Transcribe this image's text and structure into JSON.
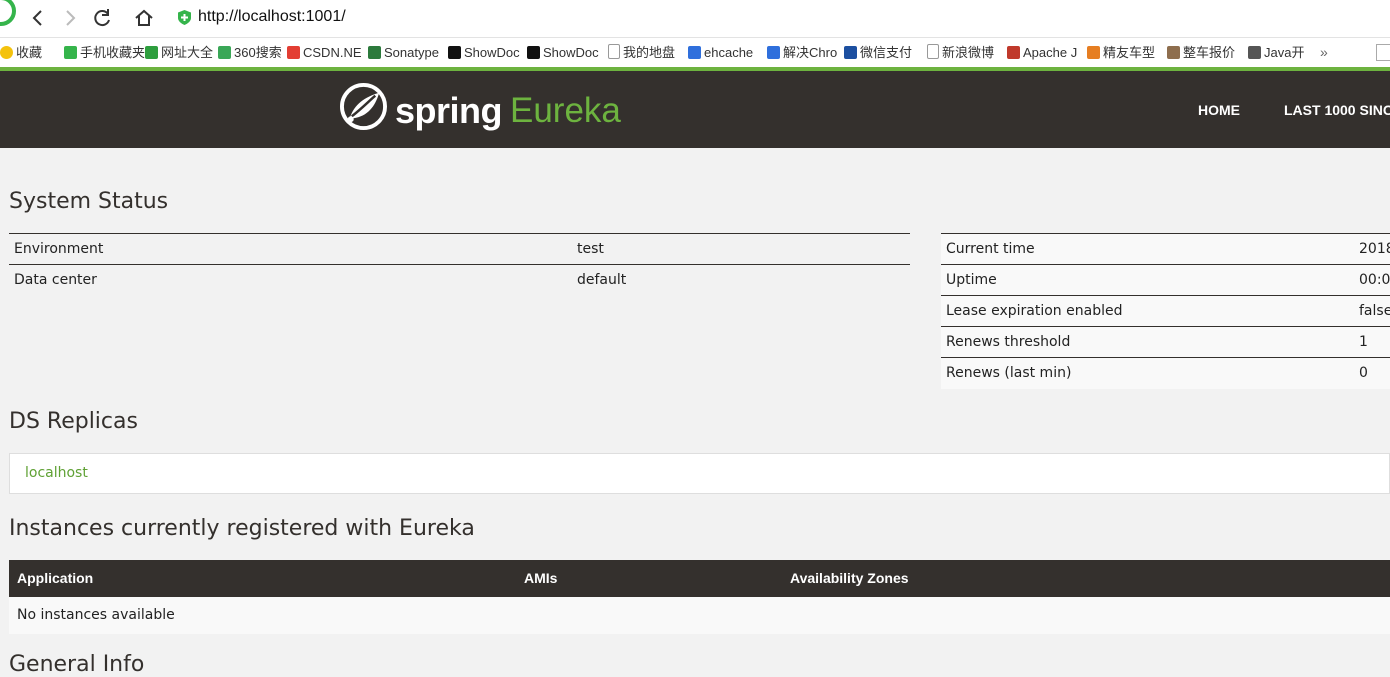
{
  "browser": {
    "url": "http://localhost:1001/",
    "bookmarks": [
      {
        "label": "收藏",
        "icon": "star-icon",
        "color": "#f4c20d"
      },
      {
        "label": "手机收藏夹",
        "icon": "phone-icon",
        "color": "#35b44b"
      },
      {
        "label": "网址大全",
        "icon": "globe-icon",
        "color": "#2e9e3e"
      },
      {
        "label": "360搜索",
        "icon": "search-360-icon",
        "color": "#3aa757"
      },
      {
        "label": "CSDN.NE",
        "icon": "csdn-icon",
        "color": "#e33e33"
      },
      {
        "label": "Sonatype",
        "icon": "sonatype-icon",
        "color": "#2c7a3c"
      },
      {
        "label": "ShowDoc",
        "icon": "showdoc-icon",
        "color": "#111111"
      },
      {
        "label": "ShowDoc",
        "icon": "showdoc-icon",
        "color": "#111111"
      },
      {
        "label": "我的地盘",
        "icon": "page-icon",
        "color": "#999999"
      },
      {
        "label": "ehcache",
        "icon": "baidu-paw-icon",
        "color": "#2f6fdc"
      },
      {
        "label": "解决Chro",
        "icon": "baidu-paw-icon",
        "color": "#2f6fdc"
      },
      {
        "label": "微信支付",
        "icon": "wechat-pay-icon",
        "color": "#1c4fa0"
      },
      {
        "label": "新浪微博",
        "icon": "page-icon",
        "color": "#999999"
      },
      {
        "label": "Apache J",
        "icon": "apache-feather-icon",
        "color": "#c0392b"
      },
      {
        "label": "精友车型",
        "icon": "jingyou-icon",
        "color": "#e67e22"
      },
      {
        "label": "整车报价",
        "icon": "image-icon",
        "color": "#8e6e4e"
      },
      {
        "label": "Java开",
        "icon": "java-icon",
        "color": "#555555"
      }
    ],
    "more_label": "»"
  },
  "header": {
    "logo_spring": "spring",
    "logo_eureka": "Eureka",
    "nav": [
      "HOME",
      "LAST 1000 SINC"
    ]
  },
  "system_status": {
    "title": "System Status",
    "left": [
      {
        "label": "Environment",
        "value": "test"
      },
      {
        "label": "Data center",
        "value": "default"
      }
    ],
    "right": [
      {
        "label": "Current time",
        "value": "2018"
      },
      {
        "label": "Uptime",
        "value": "00:0"
      },
      {
        "label": "Lease expiration enabled",
        "value": "false"
      },
      {
        "label": "Renews threshold",
        "value": "1"
      },
      {
        "label": "Renews (last min)",
        "value": "0"
      }
    ]
  },
  "ds_replicas": {
    "title": "DS Replicas",
    "items": [
      "localhost"
    ]
  },
  "instances": {
    "title": "Instances currently registered with Eureka",
    "columns": [
      "Application",
      "AMIs",
      "Availability Zones"
    ],
    "empty_text": "No instances available"
  },
  "general_info": {
    "title": "General Info"
  },
  "colors": {
    "header_bg": "#34302d",
    "accent_green": "#6db33f",
    "page_bg": "#f2f2f2"
  }
}
